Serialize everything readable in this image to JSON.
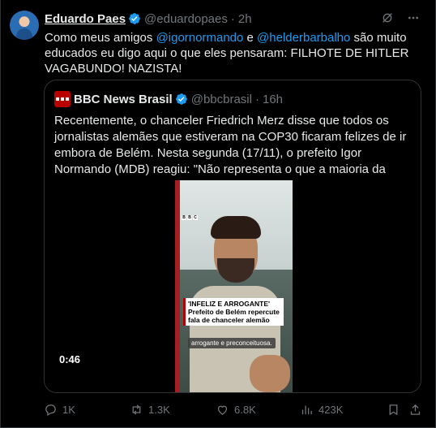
{
  "post": {
    "author_name": "Eduardo Paes",
    "author_handle": "@eduardopaes",
    "separator": "·",
    "age": "2h",
    "text_parts": {
      "t1": "Como meus amigos ",
      "m1": "@igornormando",
      "t2": " e ",
      "m2": "@helderbarbalho",
      "t3": " são muito educados eu digo aqui o que eles pensaram:  FILHOTE DE HITLER VAGABUNDO! NAZISTA!"
    }
  },
  "quote": {
    "author_name": "BBC News Brasil",
    "author_handle": "@bbcbrasil",
    "separator": "·",
    "age": "16h",
    "text": "Recentemente, o chanceler Friedrich Merz disse que todos os jornalistas alemães que estiveram na COP30 ficaram felizes de ir embora de Belém. Nesta segunda (17/11), o prefeito Igor Normando (MDB) reagiu: \"Não representa o que a maioria da população do mundo tem achado\"",
    "video": {
      "logo_letters": [
        "B",
        "B",
        "C"
      ],
      "headline": "'INFELIZ E ARROGANTE'",
      "subheadline": "Prefeito de Belém repercute fala de chanceler alemão",
      "subtitle": "arrogante e preconceituosa.",
      "duration": "0:46"
    }
  },
  "actions": {
    "replies": "1K",
    "reposts": "1.3K",
    "likes": "6.8K",
    "views": "423K"
  },
  "colors": {
    "background": "#000000",
    "text": "#e7e9ea",
    "muted": "#71767b",
    "accent": "#1d9bf0",
    "border": "#2f3336"
  },
  "icons": [
    "verified-badge-icon",
    "grok-icon",
    "more-icon",
    "reply-icon",
    "repost-icon",
    "like-icon",
    "views-icon",
    "bookmark-icon",
    "share-icon"
  ]
}
